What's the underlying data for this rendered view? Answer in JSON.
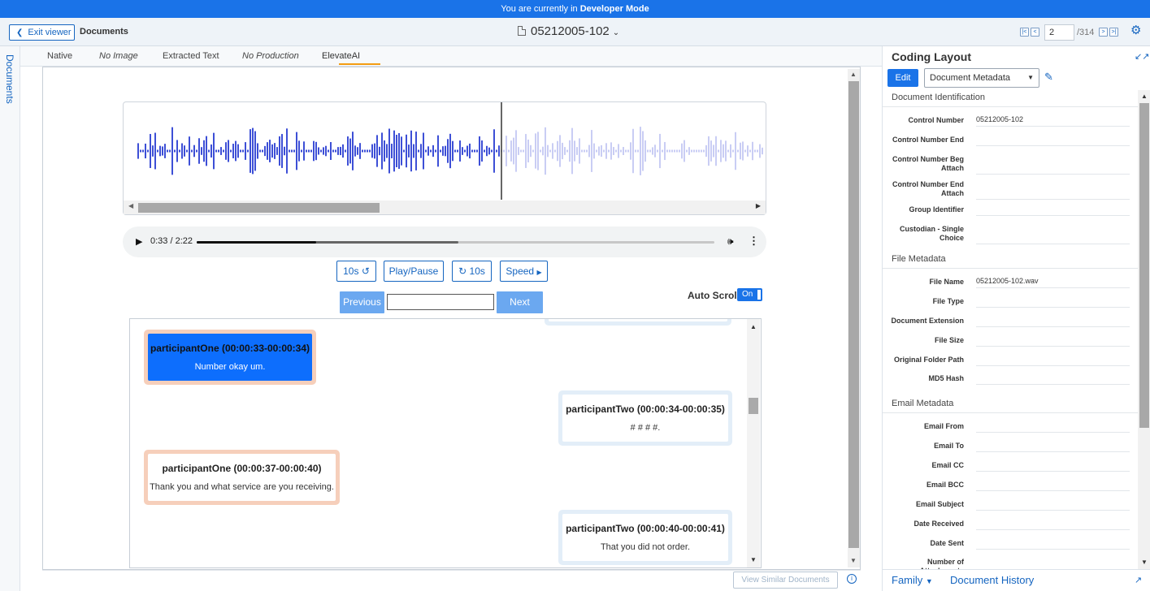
{
  "dev_banner": {
    "prefix": "You are currently in ",
    "mode": "Developer Mode"
  },
  "topbar": {
    "exit_label": "Exit viewer",
    "breadcrumb": "Documents",
    "doc_title": "05212005-102",
    "page_current": "2",
    "page_total": "/314"
  },
  "left_rail": {
    "label": "Documents"
  },
  "tabs": [
    {
      "label": "Native"
    },
    {
      "label": "No Image"
    },
    {
      "label": "Extracted Text"
    },
    {
      "label": "No Production"
    },
    {
      "label": "ElevateAI"
    }
  ],
  "player": {
    "time": "0:33 / 2:22",
    "progress_played": 0.23,
    "progress_buffered": 0.506
  },
  "controls": {
    "rewind": "10s",
    "play_pause": "Play/Pause",
    "forward": "10s",
    "speed": "Speed"
  },
  "search": {
    "previous": "Previous",
    "next": "Next",
    "value": ""
  },
  "autoscroll": {
    "label": "Auto Scroll",
    "state": "On"
  },
  "transcript": [
    {
      "speaker": "participantOne (00:00:33-00:00:34)",
      "text": "Number okay um.",
      "side": "left",
      "active": true
    },
    {
      "speaker": "participantTwo (00:00:34-00:00:35)",
      "text": "# # # #.",
      "side": "right",
      "active": false
    },
    {
      "speaker": "participantOne (00:00:37-00:00:40)",
      "text": "Thank you and what service are you receiving.",
      "side": "left",
      "active": false
    },
    {
      "speaker": "participantTwo (00:00:40-00:00:41)",
      "text": "That you did not order.",
      "side": "right",
      "active": false
    }
  ],
  "similar_docs": "View Similar Documents",
  "coding_panel": {
    "title": "Coding Layout",
    "edit_label": "Edit",
    "layout_select": "Document Metadata",
    "sections": [
      {
        "title": "Document Identification",
        "fields": [
          {
            "label": "Control Number",
            "value": "05212005-102"
          },
          {
            "label": "Control Number End",
            "value": ""
          },
          {
            "label": "Control Number Beg Attach",
            "value": ""
          },
          {
            "label": "Control Number End Attach",
            "value": ""
          },
          {
            "label": "Group Identifier",
            "value": ""
          },
          {
            "label": "Custodian - Single Choice",
            "value": ""
          }
        ]
      },
      {
        "title": "File Metadata",
        "fields": [
          {
            "label": "File Name",
            "value": "05212005-102.wav"
          },
          {
            "label": "File Type",
            "value": ""
          },
          {
            "label": "Document Extension",
            "value": ""
          },
          {
            "label": "File Size",
            "value": ""
          },
          {
            "label": "Original Folder Path",
            "value": ""
          },
          {
            "label": "MD5 Hash",
            "value": ""
          }
        ]
      },
      {
        "title": "Email Metadata",
        "fields": [
          {
            "label": "Email From",
            "value": ""
          },
          {
            "label": "Email To",
            "value": ""
          },
          {
            "label": "Email CC",
            "value": ""
          },
          {
            "label": "Email BCC",
            "value": ""
          },
          {
            "label": "Email Subject",
            "value": ""
          },
          {
            "label": "Date Received",
            "value": ""
          },
          {
            "label": "Date Sent",
            "value": ""
          },
          {
            "label": "Number of Attachments",
            "value": ""
          }
        ]
      }
    ],
    "footer_family": "Family",
    "footer_history": "Document History"
  },
  "colors": {
    "accent": "#1a73e8",
    "dev_bar": "#1a73e8",
    "participant_one": "#f6cfbb",
    "participant_two": "#e3eef8",
    "wave_played": "#3d4fd6",
    "wave_unplayed": "#c9cdf4",
    "tab_underline": "#f39c12"
  },
  "icons": {
    "back": "chevron-left-icon",
    "file": "file-icon",
    "settings": "gear-icon",
    "edit": "pencil-icon",
    "info": "info-icon"
  }
}
